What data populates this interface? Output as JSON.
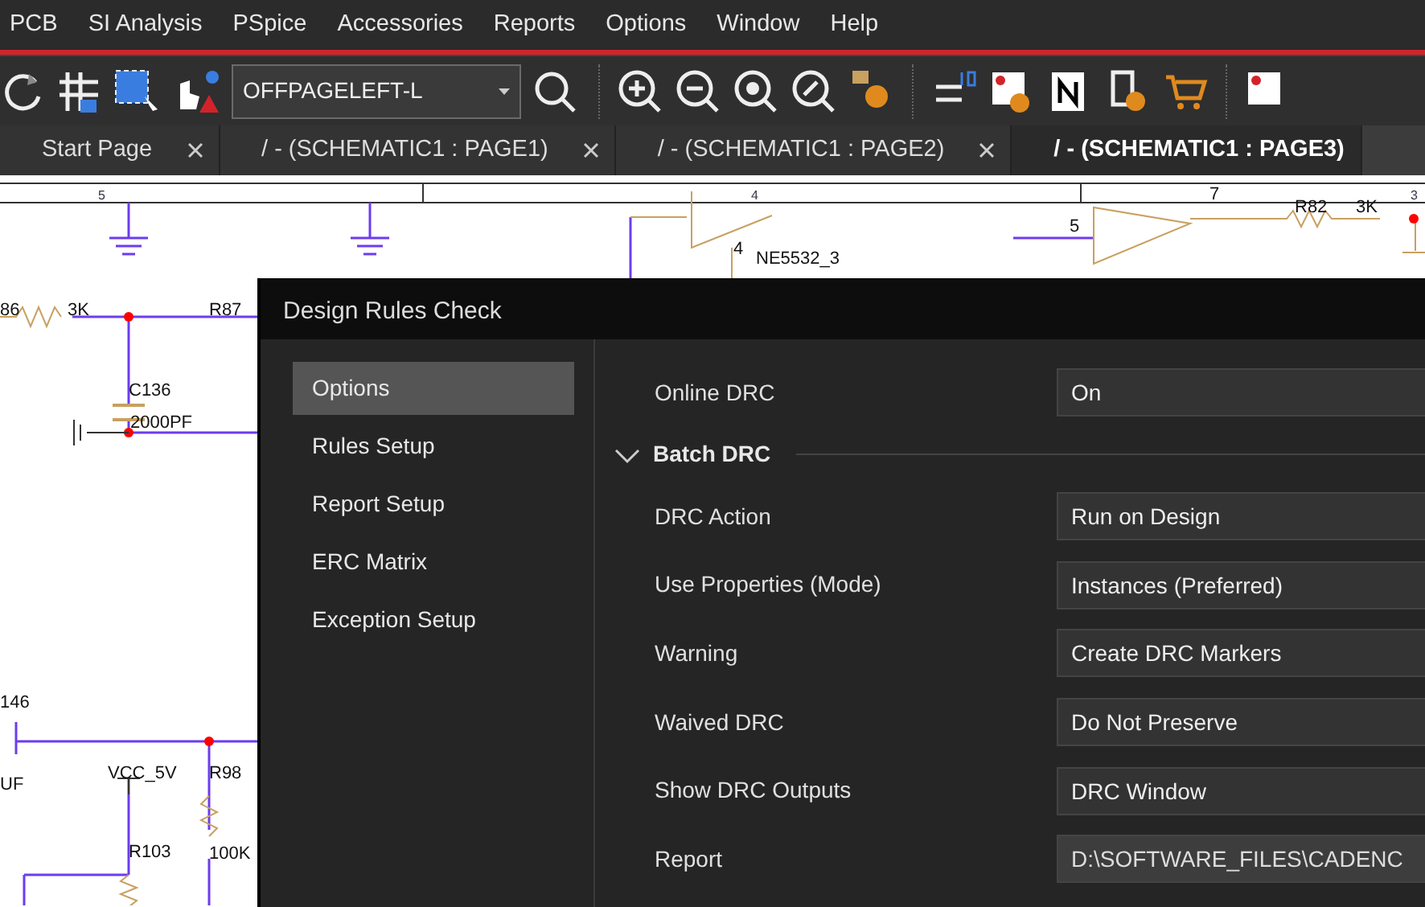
{
  "menu": [
    "PCB",
    "SI Analysis",
    "PSpice",
    "Accessories",
    "Reports",
    "Options",
    "Window",
    "Help"
  ],
  "toolbar": {
    "combo_value": "OFFPAGELEFT-L"
  },
  "tabs": [
    {
      "label": "Start Page",
      "selected": false
    },
    {
      "label": "/ - (SCHEMATIC1 : PAGE1)",
      "selected": false
    },
    {
      "label": "/ - (SCHEMATIC1 : PAGE2)",
      "selected": false
    },
    {
      "label": "/ - (SCHEMATIC1 : PAGE3)",
      "selected": true
    }
  ],
  "schematic": {
    "border_numbers": [
      "5",
      "4",
      "3"
    ],
    "labels": [
      "86",
      "3K",
      "R87",
      "C136",
      "2000PF",
      "146",
      "UF",
      "VCC_5V",
      "R98",
      "R103",
      "100K",
      "NE5532_3",
      "4",
      "5",
      "7",
      "R82",
      "3K"
    ]
  },
  "dialog": {
    "title": "Design Rules Check",
    "nav": [
      {
        "label": "Options",
        "selected": true
      },
      {
        "label": "Rules Setup",
        "selected": false
      },
      {
        "label": "Report Setup",
        "selected": false
      },
      {
        "label": "ERC Matrix",
        "selected": false
      },
      {
        "label": "Exception Setup",
        "selected": false
      }
    ],
    "rows": [
      {
        "kind": "dropdown",
        "label": "Online DRC",
        "value": "On"
      },
      {
        "kind": "section",
        "label": "Batch DRC",
        "expanded": true
      },
      {
        "kind": "dropdown",
        "label": "DRC Action",
        "value": "Run on Design"
      },
      {
        "kind": "dropdown",
        "label": "Use Properties (Mode)",
        "value": "Instances (Preferred)"
      },
      {
        "kind": "dropdown",
        "label": "Warning",
        "value": "Create DRC Markers"
      },
      {
        "kind": "dropdown",
        "label": "Waived DRC",
        "value": "Do Not Preserve"
      },
      {
        "kind": "dropdown",
        "label": "Show DRC Outputs",
        "value": "DRC Window"
      },
      {
        "kind": "path",
        "label": "Report",
        "value": "D:\\SOFTWARE_FILES\\CADENC"
      }
    ]
  }
}
